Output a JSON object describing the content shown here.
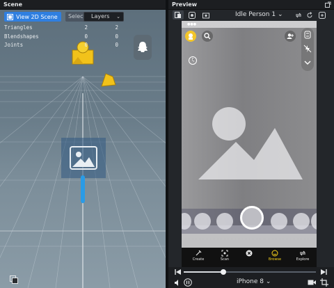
{
  "scene": {
    "title": "Scene",
    "view2d_label": "View 2D Scene",
    "selection_label": "Selection",
    "layers_label": "Layers",
    "stats": [
      {
        "label": "Triangles",
        "a": "2",
        "b": "2"
      },
      {
        "label": "Blendshapes",
        "a": "0",
        "b": "0"
      },
      {
        "label": "Joints",
        "a": "0",
        "b": "0"
      }
    ]
  },
  "preview": {
    "title": "Preview",
    "person_label": "Idle Person 1",
    "device_label": "iPhone 8",
    "progress": 0.3,
    "nav": [
      {
        "label": "Create",
        "icon": "create-icon"
      },
      {
        "label": "Scan",
        "icon": "scan-icon"
      },
      {
        "label": "",
        "icon": "close-icon"
      },
      {
        "label": "Browse",
        "icon": "browse-icon"
      },
      {
        "label": "Explore",
        "icon": "explore-icon"
      }
    ]
  },
  "colors": {
    "accent": "#2f7fe0",
    "snap_yellow": "#f7d21c",
    "gizmo": "#f2c21a",
    "object_blue": "#2a9be6"
  }
}
